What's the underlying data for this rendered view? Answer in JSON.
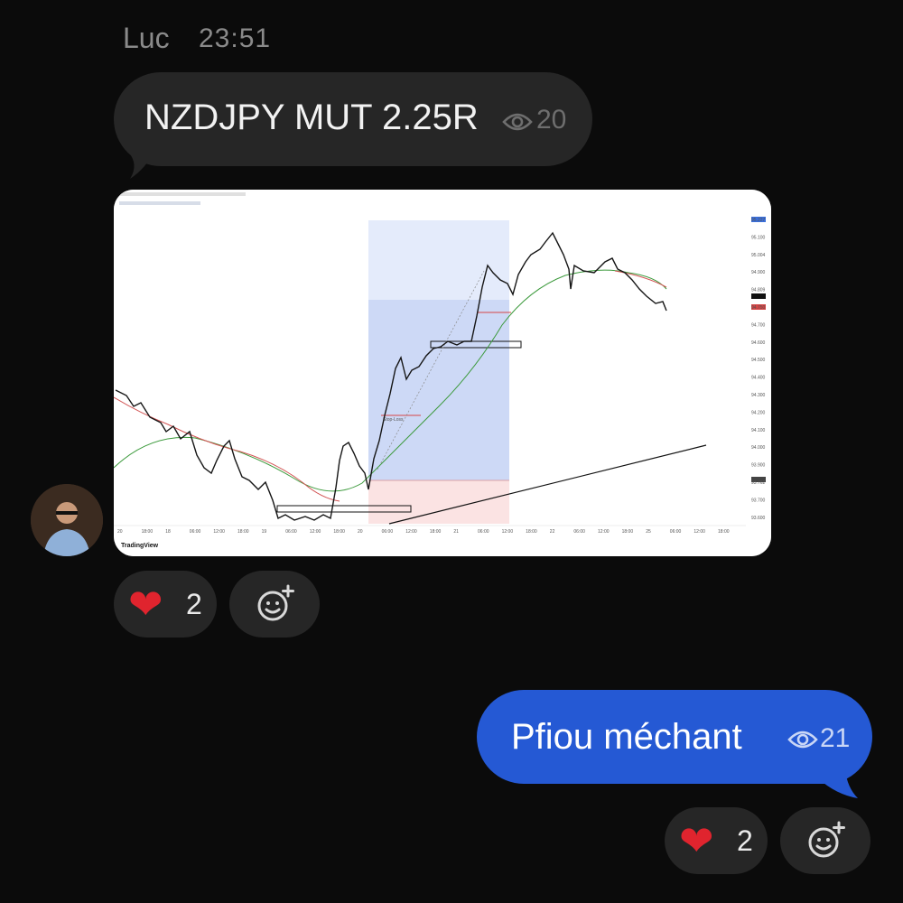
{
  "message1": {
    "sender": "Luc",
    "time": "23:51",
    "text": "NZDJPY MUT 2.25R",
    "views": "20",
    "reaction": {
      "emoji": "heart",
      "count": "2"
    }
  },
  "chart": {
    "brand": "TradingView",
    "x_ticks": [
      "20",
      "18:00",
      "18",
      "06:00",
      "12:00",
      "18:00",
      "19",
      "06:00",
      "12:00",
      "18:00",
      "20",
      "06:00",
      "12:00",
      "18:00",
      "21",
      "06:00",
      "12:00",
      "18:00",
      "22",
      "06:00",
      "12:00",
      "18:00",
      "25",
      "06:00",
      "12:00",
      "18:00"
    ],
    "y_ticks": [
      "95.227",
      "95.100",
      "95.004",
      "94.900",
      "94.809",
      "94.750",
      "94.700",
      "94.600",
      "94.500",
      "94.400",
      "94.300",
      "94.200",
      "94.100",
      "94.000",
      "93.900",
      "93.762",
      "93.700",
      "93.600"
    ],
    "stop_label": "Stop-Loss",
    "colors": {
      "tp_zone": "#c9d7f6",
      "sl_zone": "#fbe0e0",
      "ema_fast": "#d25454",
      "ema_slow": "#3c9a3c"
    }
  },
  "message2": {
    "text": "Pfiou méchant",
    "views": "21",
    "reaction": {
      "emoji": "heart",
      "count": "2"
    }
  },
  "icons": {
    "views": "eye-icon",
    "add_reaction": "add-reaction-icon",
    "heart": "heart-icon"
  }
}
